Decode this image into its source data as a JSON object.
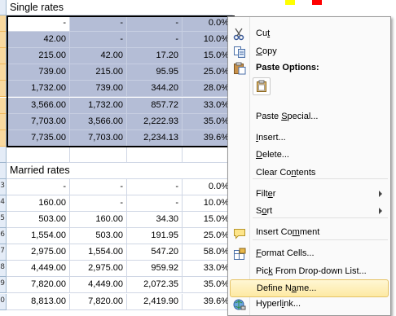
{
  "sheet": {
    "single_title": "Single rates",
    "married_title": "Married rates",
    "single_rows": [
      [
        "-",
        "-",
        "-",
        "0.0%"
      ],
      [
        "42.00",
        "-",
        "-",
        "10.0%"
      ],
      [
        "215.00",
        "42.00",
        "17.20",
        "15.0%"
      ],
      [
        "739.00",
        "215.00",
        "95.95",
        "25.0%"
      ],
      [
        "1,732.00",
        "739.00",
        "344.20",
        "28.0%"
      ],
      [
        "3,566.00",
        "1,732.00",
        "857.72",
        "33.0%"
      ],
      [
        "7,703.00",
        "3,566.00",
        "2,222.93",
        "35.0%"
      ],
      [
        "7,735.00",
        "7,703.00",
        "2,234.13",
        "39.6%"
      ]
    ],
    "married_rows": [
      [
        "-",
        "-",
        "-",
        "0.0%"
      ],
      [
        "160.00",
        "-",
        "-",
        "10.0%"
      ],
      [
        "503.00",
        "160.00",
        "34.30",
        "15.0%"
      ],
      [
        "1,554.00",
        "503.00",
        "191.95",
        "25.0%"
      ],
      [
        "2,975.00",
        "1,554.00",
        "547.20",
        "58.0%"
      ],
      [
        "4,449.00",
        "2,975.00",
        "959.92",
        "33.0%"
      ],
      [
        "7,820.00",
        "4,449.00",
        "2,072.35",
        "35.0%"
      ],
      [
        "8,813.00",
        "7,820.00",
        "2,419.90",
        "39.6%"
      ]
    ],
    "single_row_numbers": [
      "",
      "",
      "",
      "",
      "",
      "",
      "",
      ""
    ],
    "married_row_numbers": [
      "3",
      "4",
      "5",
      "6",
      "7",
      "8",
      "9",
      "0"
    ]
  },
  "context_menu": {
    "items": [
      {
        "icon": "scissors-icon",
        "pre": "Cu",
        "key": "t",
        "post": "",
        "bold": false,
        "submenu": false,
        "hover": false
      },
      {
        "icon": "copy-icon",
        "pre": "",
        "key": "C",
        "post": "opy",
        "bold": false,
        "submenu": false,
        "hover": false
      },
      {
        "icon": "clipboard-icon",
        "pre": "Paste Options:",
        "key": "",
        "post": "",
        "bold": true,
        "submenu": false,
        "hover": false
      },
      {
        "icon": "",
        "pre": "Paste ",
        "key": "S",
        "post": "pecial...",
        "bold": false,
        "submenu": false,
        "hover": false
      },
      {
        "icon": "",
        "pre": "",
        "key": "I",
        "post": "nsert...",
        "bold": false,
        "submenu": false,
        "hover": false
      },
      {
        "icon": "",
        "pre": "",
        "key": "D",
        "post": "elete...",
        "bold": false,
        "submenu": false,
        "hover": false
      },
      {
        "icon": "",
        "pre": "Clear Co",
        "key": "n",
        "post": "tents",
        "bold": false,
        "submenu": false,
        "hover": false
      },
      {
        "icon": "",
        "pre": "Filt",
        "key": "e",
        "post": "r",
        "bold": false,
        "submenu": true,
        "hover": false
      },
      {
        "icon": "",
        "pre": "S",
        "key": "o",
        "post": "rt",
        "bold": false,
        "submenu": true,
        "hover": false
      },
      {
        "icon": "comment-icon",
        "pre": "Insert Co",
        "key": "m",
        "post": "ment",
        "bold": false,
        "submenu": false,
        "hover": false
      },
      {
        "icon": "format-cells-icon",
        "pre": "",
        "key": "F",
        "post": "ormat Cells...",
        "bold": false,
        "submenu": false,
        "hover": false
      },
      {
        "icon": "",
        "pre": "Pic",
        "key": "k",
        "post": " From Drop-down List...",
        "bold": false,
        "submenu": false,
        "hover": false
      },
      {
        "icon": "",
        "pre": "Define N",
        "key": "a",
        "post": "me...",
        "bold": false,
        "submenu": false,
        "hover": true
      },
      {
        "icon": "hyperlink-icon",
        "pre": "Hyperl",
        "key": "i",
        "post": "nk...",
        "bold": false,
        "submenu": false,
        "hover": false
      }
    ]
  },
  "colors": {
    "selection_fill": "#b4bdd6",
    "menu_hover": "#fde9a3",
    "row_header_selected": "#f9d99f"
  }
}
